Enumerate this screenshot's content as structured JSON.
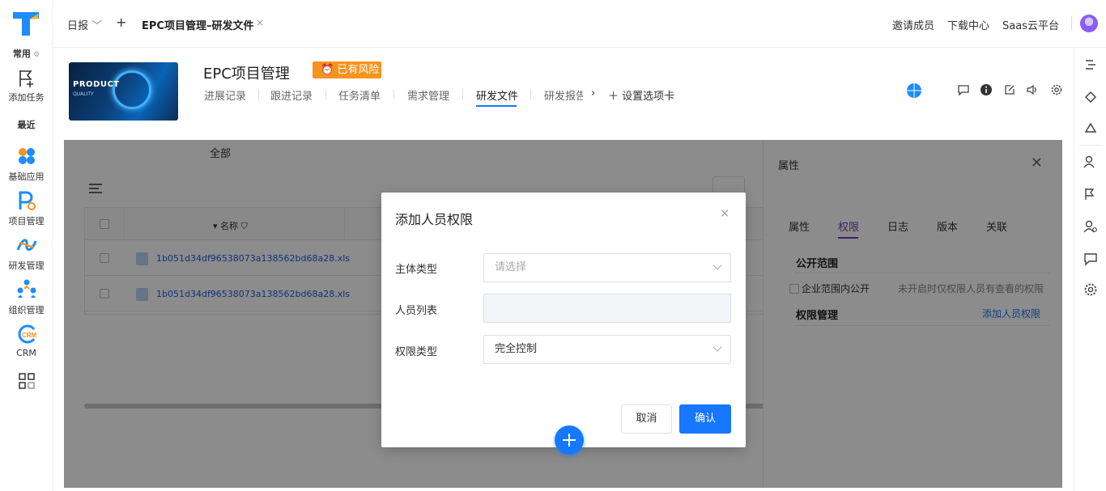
{
  "leftnav": {
    "common_label": "常用",
    "add_task": "添加任务",
    "recent_label": "最近",
    "items": [
      "基础应用",
      "项目管理",
      "研发管理",
      "组织管理",
      "CRM"
    ]
  },
  "topbar": {
    "report_menu": "日报",
    "add_symbol": "+",
    "active_tab": "EPC项目管理–研发文件",
    "tab_close": "×",
    "invite": "邀请成员",
    "download": "下载中心",
    "saas": "Saas云平台"
  },
  "project": {
    "image_title": "PRODUCT",
    "image_subtitle": "QUALITY",
    "title": "EPC项目管理",
    "risk_badge": "已有风险",
    "tabs": [
      "进展记录",
      "跟进记录",
      "任务清单",
      "需求管理",
      "研发文件",
      "研发报告"
    ],
    "active_tab_index": 4,
    "settings_tab": "设置选项卡"
  },
  "content": {
    "filter_all": "全部",
    "table": {
      "header_name": "名称",
      "rows": [
        {
          "file": "1b051d34df96538073a138562bd68a28.xls"
        },
        {
          "file": "1b051d34df96538073a138562bd68a28.xls"
        }
      ]
    }
  },
  "side_panel": {
    "title": "属性",
    "tabs": [
      "属性",
      "权限",
      "日志",
      "版本",
      "关联"
    ],
    "active_tab_index": 1,
    "public_scope": "公开范围",
    "enterprise_public": "企业范围内公开",
    "hint": "未开启时仅权限人员有查看的权限",
    "perm_manage": "权限管理",
    "add_perm_link": "添加人员权限"
  },
  "modal": {
    "title": "添加人员权限",
    "close": "×",
    "subject_type_label": "主体类型",
    "subject_type_placeholder": "请选择",
    "person_list_label": "人员列表",
    "perm_type_label": "权限类型",
    "perm_type_value": "完全控制",
    "cancel": "取消",
    "confirm": "确认"
  },
  "colors": {
    "accent": "#1677ff",
    "risk": "#f7941d",
    "panel_tab_active": "#6a3dbd"
  }
}
